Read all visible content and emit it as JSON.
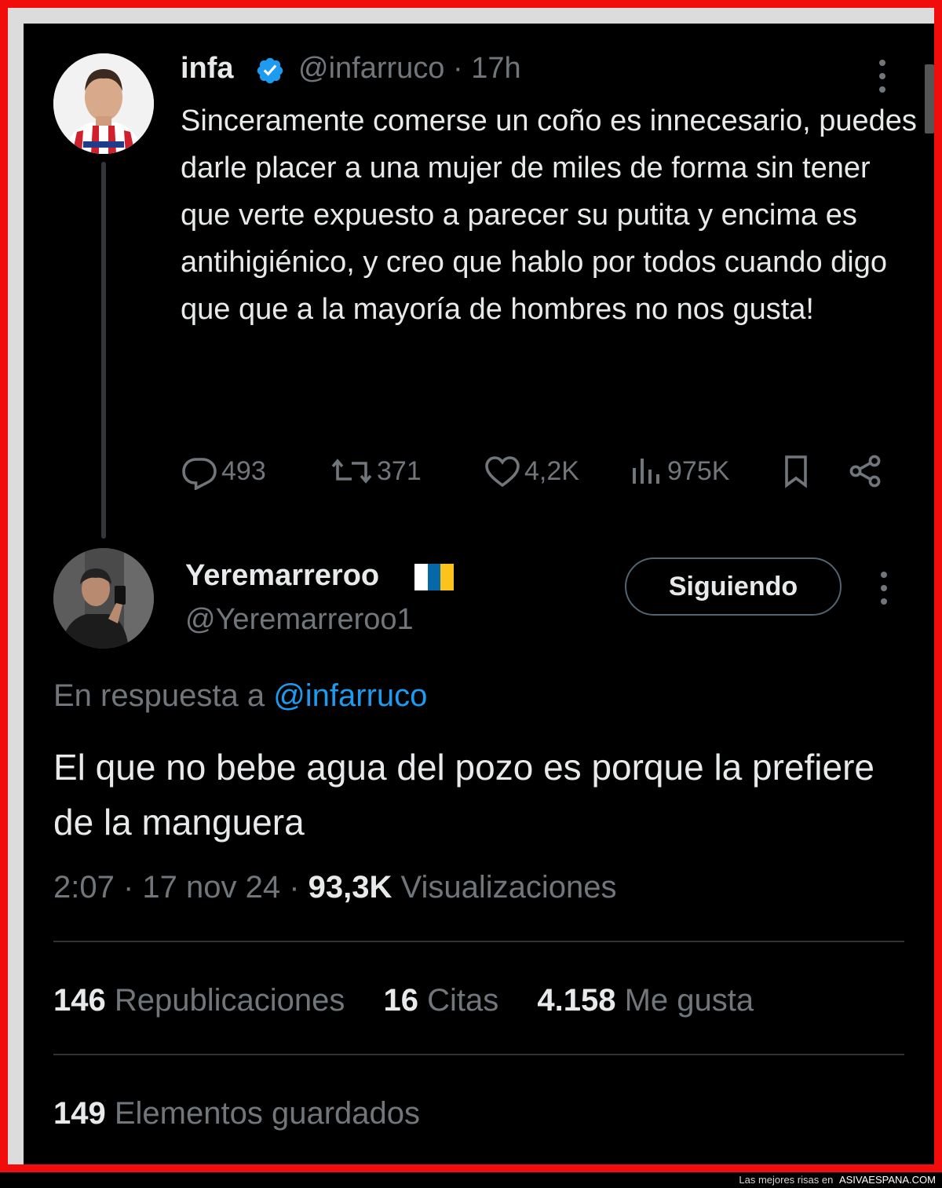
{
  "colors": {
    "background": "#000000",
    "frame_red": "#f20d0d",
    "text_primary": "#e7e9ea",
    "text_secondary": "#71767b",
    "link_blue": "#1d9bf0",
    "verified_blue": "#1d9bf0"
  },
  "tweet_original": {
    "display_name": "infa",
    "verified_icon": "verified-badge-icon",
    "handle_time": "@infarruco · 17h",
    "text": "Sinceramente comerse un coño es innecesario, puedes darle placer a una mujer de miles de forma sin tener que verte expuesto a parecer su putita y encima es antihigiénico, y creo que hablo por todos cuando digo que que a la mayoría de hombres no nos gusta!",
    "actions": {
      "replies": "493",
      "retweets": "371",
      "likes": "4,2K",
      "views": "975K"
    }
  },
  "tweet_reply": {
    "display_name": "Yeremarreroo",
    "flag_icon": "canary-islands-flag-icon",
    "handle": "@Yeremarreroo1",
    "follow_button": "Siguiendo",
    "reply_prefix": "En respuesta a ",
    "reply_mention": "@infarruco",
    "text": "El que no bebe agua del pozo es porque la prefiere de la manguera",
    "timestamp": "2:07 · 17 nov 24 · ",
    "views_count": "93,3K",
    "views_label": " Visualizaciones",
    "stats": {
      "reposts_count": "146",
      "reposts_label": " Republicaciones",
      "quotes_count": "16",
      "quotes_label": " Citas",
      "likes_count": "4.158",
      "likes_label": " Me gusta",
      "saved_count": "149",
      "saved_label": " Elementos guardados"
    }
  },
  "footer": {
    "prefix": "Las mejores risas en ",
    "site": "ASIVAESPANA.COM"
  }
}
